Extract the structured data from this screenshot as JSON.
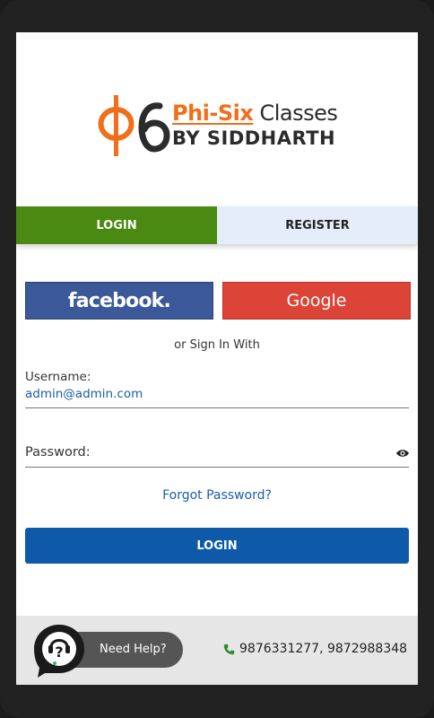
{
  "brand": {
    "logo_symbol": "Φ6",
    "line1_orange": "Phi-Six",
    "line1_dark": "Classes",
    "line2": "BY SIDDHARTH",
    "orange": "#ef6f1a"
  },
  "tabs": {
    "login": "LOGIN",
    "register": "REGISTER"
  },
  "social": {
    "facebook": "facebook.",
    "google": "Google"
  },
  "or_text": "or Sign In With",
  "form": {
    "username_label": "Username:",
    "username_value": "admin@admin.com",
    "password_label": "Password:",
    "password_icon": "eye-icon",
    "forgot": "Forgot Password?",
    "submit": "LOGIN"
  },
  "footer": {
    "help": "Need Help?",
    "help_icon": "question-bubble-icon",
    "phone_icon": "phone-icon",
    "phones": "9876331277, 9872988348"
  },
  "colors": {
    "login_tab": "#4b8a12",
    "register_tab": "#e4edf9",
    "primary": "#0f5aa8",
    "facebook": "#3b5898",
    "google": "#db4437"
  }
}
